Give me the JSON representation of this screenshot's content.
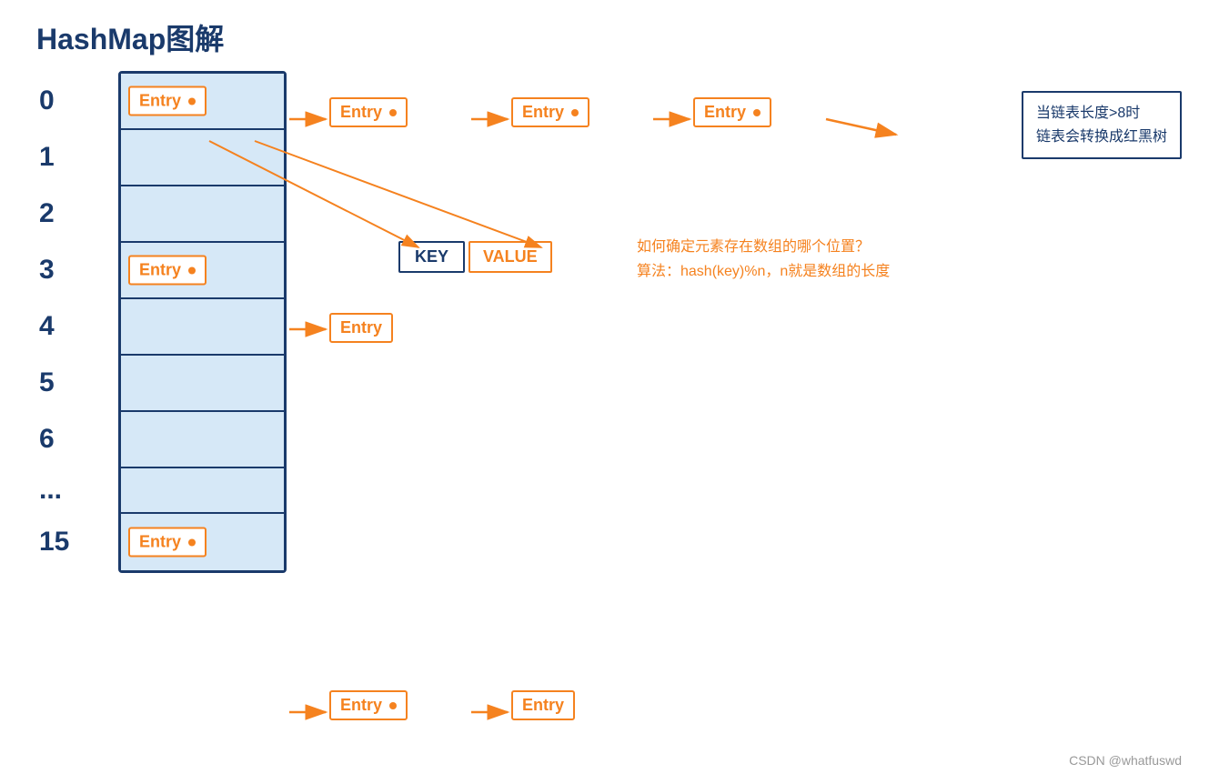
{
  "title": "HashMap图解",
  "array": {
    "rows": [
      {
        "index": "0",
        "hasEntry": true
      },
      {
        "index": "1",
        "hasEntry": false
      },
      {
        "index": "2",
        "hasEntry": false
      },
      {
        "index": "3",
        "hasEntry": true
      },
      {
        "index": "4",
        "hasEntry": false
      },
      {
        "index": "5",
        "hasEntry": false
      },
      {
        "index": "6",
        "hasEntry": false
      },
      {
        "index": "...",
        "hasEntry": false
      },
      {
        "index": "15",
        "hasEntry": true
      }
    ]
  },
  "row0": {
    "entry1": "Entry",
    "entry2": "Entry",
    "entry3": "Entry",
    "entry4": "Entry"
  },
  "row3": {
    "entry1": "Entry",
    "entry2": "Entry"
  },
  "row15": {
    "entry1": "Entry",
    "entry2": "Entry",
    "entry3": "Entry"
  },
  "key_label": "KEY",
  "value_label": "VALUE",
  "note": {
    "line1": "当链表长度>8时",
    "line2": "链表会转换成红黑树"
  },
  "info": {
    "line1": "如何确定元素存在数组的哪个位置？",
    "line2": "算法：hash(key)%n，n就是数组的长度"
  },
  "csdn": "CSDN @whatfuswd",
  "colors": {
    "orange": "#f5821f",
    "navy": "#1a3a6b",
    "bg": "#d6e8f7"
  }
}
